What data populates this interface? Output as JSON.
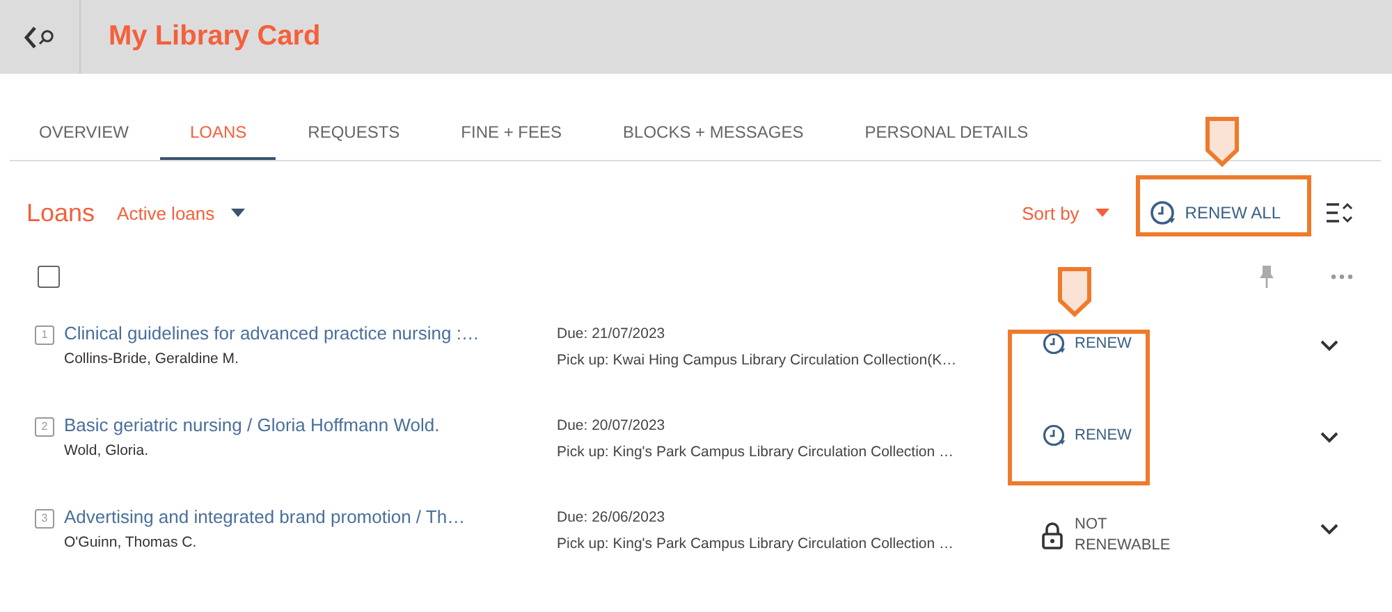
{
  "header": {
    "title": "My Library Card"
  },
  "tabs": [
    {
      "label": "OVERVIEW",
      "selected": false
    },
    {
      "label": "LOANS",
      "selected": true
    },
    {
      "label": "REQUESTS",
      "selected": false
    },
    {
      "label": "FINE + FEES",
      "selected": false
    },
    {
      "label": "BLOCKS + MESSAGES",
      "selected": false
    },
    {
      "label": "PERSONAL DETAILS",
      "selected": false
    }
  ],
  "toolbar": {
    "heading": "Loans",
    "filter": "Active loans",
    "sort_label": "Sort by",
    "renew_all": "RENEW ALL"
  },
  "select_all": {
    "checked": false
  },
  "loans": [
    {
      "number": "1",
      "title": "Clinical guidelines for advanced practice nursing :…",
      "author": "Collins-Bride, Geraldine M.",
      "due": "Due: 21/07/2023",
      "pickup": "Pick up: Kwai Hing Campus Library Circulation Collection(K…",
      "action": {
        "kind": "renew",
        "label": "RENEW"
      }
    },
    {
      "number": "2",
      "title": "Basic geriatric nursing / Gloria Hoffmann Wold.",
      "author": "Wold, Gloria.",
      "due": "Due: 20/07/2023",
      "pickup": "Pick up: King's Park Campus Library Circulation Collection …",
      "action": {
        "kind": "renew",
        "label": "RENEW"
      }
    },
    {
      "number": "3",
      "title": "Advertising and integrated brand promotion / Th…",
      "author": "O'Guinn, Thomas C.",
      "due": "Due: 26/06/2023",
      "pickup": "Pick up: King's Park Campus Library Circulation Collection …",
      "action": {
        "kind": "locked",
        "label": "NOT RENEWABLE"
      }
    }
  ],
  "highlights": {
    "renew_all": true,
    "renew_column": true
  }
}
